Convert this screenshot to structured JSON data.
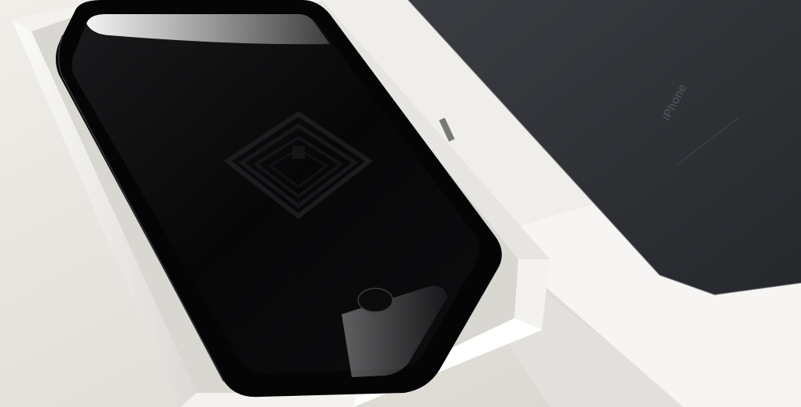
{
  "scene": {
    "description_label": "",
    "lid_text": "iPhone"
  },
  "colors": {
    "table": "#e6e3dd",
    "box_white": "#f4f3f1",
    "phone_black": "#0a0a0b",
    "lid_print": "#2c2e33"
  },
  "icons": {
    "home_button": "home-button-icon",
    "wallpaper": "layered-rhombus-wallpaper-icon"
  }
}
